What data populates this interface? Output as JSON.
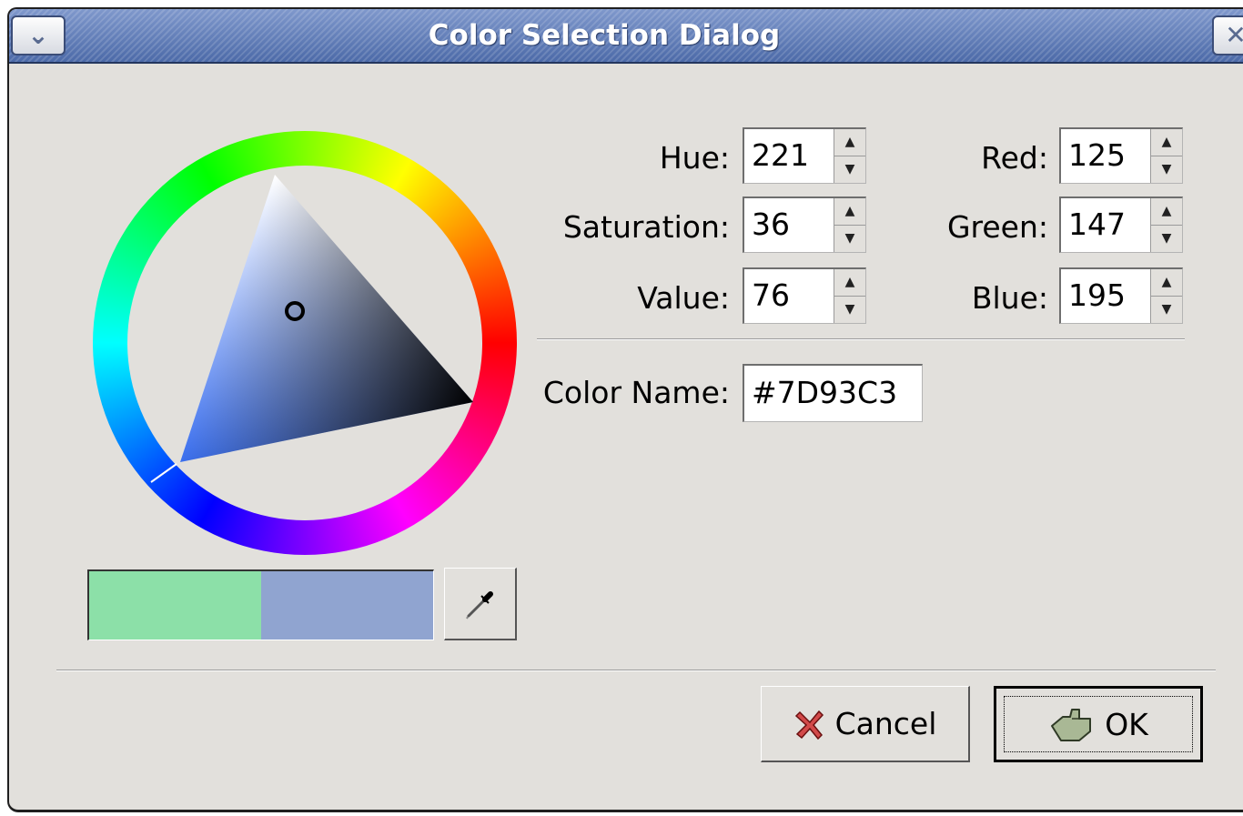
{
  "window": {
    "title": "Color Selection Dialog",
    "menu_button_icon": "chevron-down-icon",
    "close_button_icon": "close-icon"
  },
  "hsv": {
    "hue_label": "Hue:",
    "hue_value": "221",
    "saturation_label": "Saturation:",
    "saturation_value": "36",
    "value_label": "Value:",
    "value_value": "76"
  },
  "rgb": {
    "red_label": "Red:",
    "red_value": "125",
    "green_label": "Green:",
    "green_value": "147",
    "blue_label": "Blue:",
    "blue_value": "195"
  },
  "color_name": {
    "label": "Color Name:",
    "value": "#7D93C3"
  },
  "swatches": {
    "previous_color": "#8ce0a8",
    "current_color": "#90a4d0"
  },
  "colors": {
    "selected": "#7D93C3",
    "titlebar": "#5b76b3",
    "dialog_bg": "#e2e0dc"
  },
  "buttons": {
    "cancel_label": "Cancel",
    "ok_label": "OK",
    "cancel_icon": "red-x-icon",
    "ok_icon": "hand-ok-icon",
    "picker_icon": "eyedropper-icon"
  }
}
